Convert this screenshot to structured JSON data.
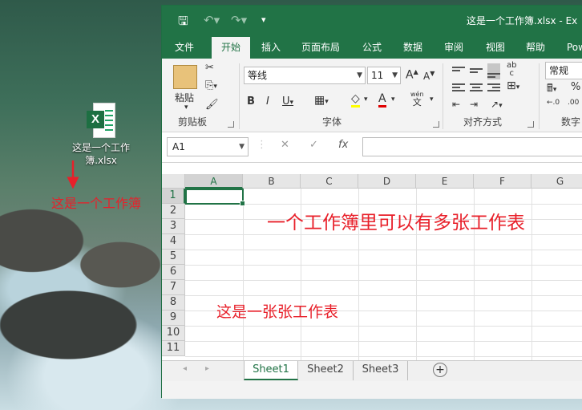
{
  "desktop": {
    "file_icon_label": "这是一个工作簿.xlsx",
    "annotation_workbook": "这是一个工作簿"
  },
  "window": {
    "title": "这是一个工作簿.xlsx",
    "title_suffix": "Ex",
    "tabs": [
      {
        "label": "文件"
      },
      {
        "label": "开始"
      },
      {
        "label": "插入"
      },
      {
        "label": "页面布局"
      },
      {
        "label": "公式"
      },
      {
        "label": "数据"
      },
      {
        "label": "审阅"
      },
      {
        "label": "视图"
      },
      {
        "label": "帮助"
      },
      {
        "label": "Pow"
      }
    ],
    "active_tab": "开始"
  },
  "ribbon": {
    "paste_label": "粘贴",
    "clipboard_label": "剪贴板",
    "font_name": "等线",
    "font_size": "11",
    "font_label": "字体",
    "alignment_label": "对齐方式",
    "number_format": "常规",
    "number_label": "数字",
    "bold": "B",
    "italic": "I",
    "underline": "U",
    "grow_font": "A",
    "shrink_font": "A",
    "phonetic_top": "wén",
    "phonetic_char": "文",
    "wrap_top": "ab",
    "wrap_bottom": "c"
  },
  "formula_bar": {
    "name_box": "A1",
    "fx": "fx"
  },
  "grid": {
    "columns": [
      "A",
      "B",
      "C",
      "D",
      "E",
      "F",
      "G"
    ],
    "rows": [
      "1",
      "2",
      "3",
      "4",
      "5",
      "6",
      "7",
      "8",
      "9",
      "10",
      "11"
    ],
    "selected_cell": "A1"
  },
  "annotations": {
    "multi_sheet": "一个工作簿里可以有多张工作表",
    "sheets_note": "这是一张张工作表"
  },
  "sheets": [
    {
      "name": "Sheet1"
    },
    {
      "name": "Sheet2"
    },
    {
      "name": "Sheet3"
    }
  ],
  "colors": {
    "excel_green": "#217346",
    "annotation_red": "#e8202a"
  }
}
